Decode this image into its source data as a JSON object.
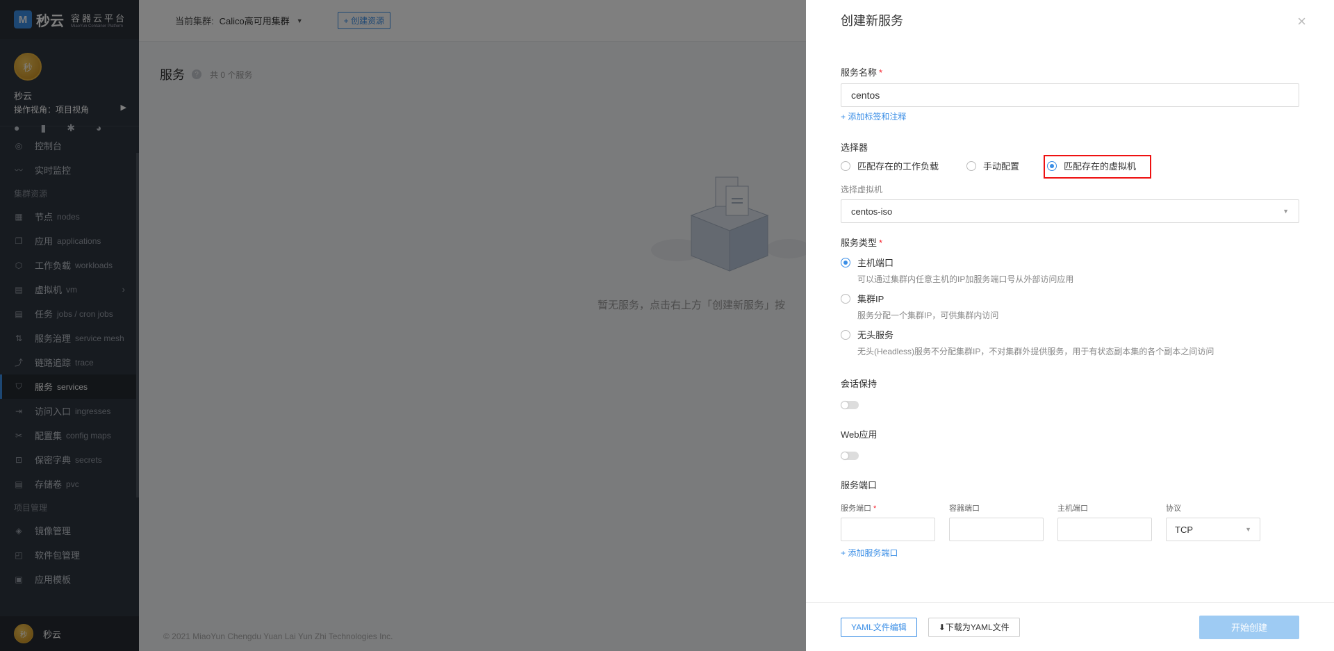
{
  "brand": {
    "logo_char": "M",
    "name": "秒云",
    "sub_title": "容器云平台",
    "sub_en": "MiaoYun Container Platform"
  },
  "user": {
    "avatar_text": "秒",
    "name": "秒云",
    "view": "操作视角：项目视角"
  },
  "sidebar": {
    "items": [
      {
        "label": "控制台",
        "en": "",
        "icon": "dashboard-icon"
      },
      {
        "label": "实时监控",
        "en": "",
        "icon": "monitor-icon"
      },
      {
        "group": "集群资源"
      },
      {
        "label": "节点",
        "en": "nodes",
        "icon": "nodes-icon"
      },
      {
        "label": "应用",
        "en": "applications",
        "icon": "applications-icon"
      },
      {
        "label": "工作负载",
        "en": "workloads",
        "icon": "workloads-icon"
      },
      {
        "label": "虚拟机",
        "en": "vm",
        "icon": "vm-icon",
        "arrow": true
      },
      {
        "label": "任务",
        "en": "jobs / cron jobs",
        "icon": "jobs-icon"
      },
      {
        "label": "服务治理",
        "en": "service mesh",
        "icon": "mesh-icon"
      },
      {
        "label": "链路追踪",
        "en": "trace",
        "icon": "trace-icon"
      },
      {
        "label": "服务",
        "en": "services",
        "icon": "services-icon",
        "active": true
      },
      {
        "label": "访问入口",
        "en": "ingresses",
        "icon": "ingress-icon"
      },
      {
        "label": "配置集",
        "en": "config maps",
        "icon": "configmap-icon"
      },
      {
        "label": "保密字典",
        "en": "secrets",
        "icon": "secret-icon"
      },
      {
        "label": "存储卷",
        "en": "pvc",
        "icon": "pvc-icon"
      },
      {
        "group": "项目管理"
      },
      {
        "label": "镜像管理",
        "en": "",
        "icon": "image-icon"
      },
      {
        "label": "软件包管理",
        "en": "",
        "icon": "package-icon"
      },
      {
        "label": "应用模板",
        "en": "",
        "icon": "template-icon"
      }
    ],
    "footer_name": "秒云"
  },
  "topbar": {
    "cluster_label": "当前集群:",
    "cluster_name": "Calico高可用集群",
    "create_resource": "+ 创建资源"
  },
  "page": {
    "title": "服务",
    "count": "共 0 个服务",
    "empty_text": "暂无服务，点击右上方「创建新服务」按",
    "copyright": "© 2021 MiaoYun Chengdu Yuan Lai Yun Zhi Technologies Inc."
  },
  "drawer": {
    "title": "创建新服务",
    "close": "×",
    "name_label": "服务名称",
    "name_value": "centos",
    "add_labels": "+ 添加标签和注释",
    "selector_label": "选择器",
    "selector_options": [
      "匹配存在的工作负载",
      "手动配置",
      "匹配存在的虚拟机"
    ],
    "vm_label": "选择虚拟机",
    "vm_value": "centos-iso",
    "type_label": "服务类型",
    "types": [
      {
        "label": "主机端口",
        "desc": "可以通过集群内任意主机的IP加服务端口号从外部访问应用",
        "checked": true
      },
      {
        "label": "集群IP",
        "desc": "服务分配一个集群IP，可供集群内访问",
        "checked": false
      },
      {
        "label": "无头服务",
        "desc": "无头(Headless)服务不分配集群IP，不对集群外提供服务，用于有状态副本集的各个副本之间访问",
        "checked": false
      }
    ],
    "session_label": "会话保持",
    "web_label": "Web应用",
    "ports_label": "服务端口",
    "port_cols": [
      "服务端口",
      "容器端口",
      "主机端口",
      "协议"
    ],
    "protocol_value": "TCP",
    "add_port": "+ 添加服务端口",
    "yaml_edit": "YAML文件编辑",
    "yaml_download": "下载为YAML文件",
    "submit": "开始创建"
  }
}
